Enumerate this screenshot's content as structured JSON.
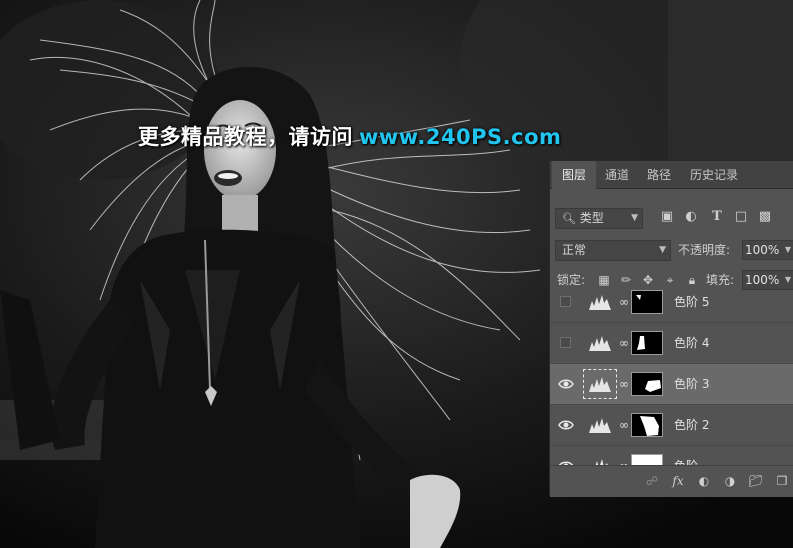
{
  "watermark": {
    "text": "更多精品教程，请访问",
    "url": "www.240PS.com"
  },
  "panel": {
    "tabs": [
      {
        "label": "图层",
        "active": true
      },
      {
        "label": "通道",
        "active": false
      },
      {
        "label": "路径",
        "active": false
      },
      {
        "label": "历史记录",
        "active": false
      }
    ],
    "filter": {
      "label": "类型",
      "icons": [
        "image-icon",
        "adjustment-icon",
        "type-icon",
        "shape-icon",
        "smart-object-icon"
      ]
    },
    "blend_mode": "正常",
    "opacity_label": "不透明度:",
    "opacity_value": "100%",
    "lock_label": "锁定:",
    "fill_label": "填充:",
    "fill_value": "100%",
    "layers": [
      {
        "name": "色阶 5",
        "visible": false,
        "selected": false
      },
      {
        "name": "色阶 4",
        "visible": false,
        "selected": false
      },
      {
        "name": "色阶 3",
        "visible": true,
        "selected": true
      },
      {
        "name": "色阶 2",
        "visible": true,
        "selected": false
      },
      {
        "name": "色阶",
        "visible": true,
        "selected": false
      }
    ],
    "footer_icons": [
      "link-icon",
      "fx-icon",
      "add-mask-icon",
      "new-adjustment-icon",
      "new-group-icon",
      "new-layer-icon",
      "delete-icon"
    ],
    "colors": {
      "panel_bg": "#535353",
      "tab_bg": "#424242",
      "selected_row": "#6a6a6a",
      "watermark_url": "#21c5ee"
    }
  }
}
